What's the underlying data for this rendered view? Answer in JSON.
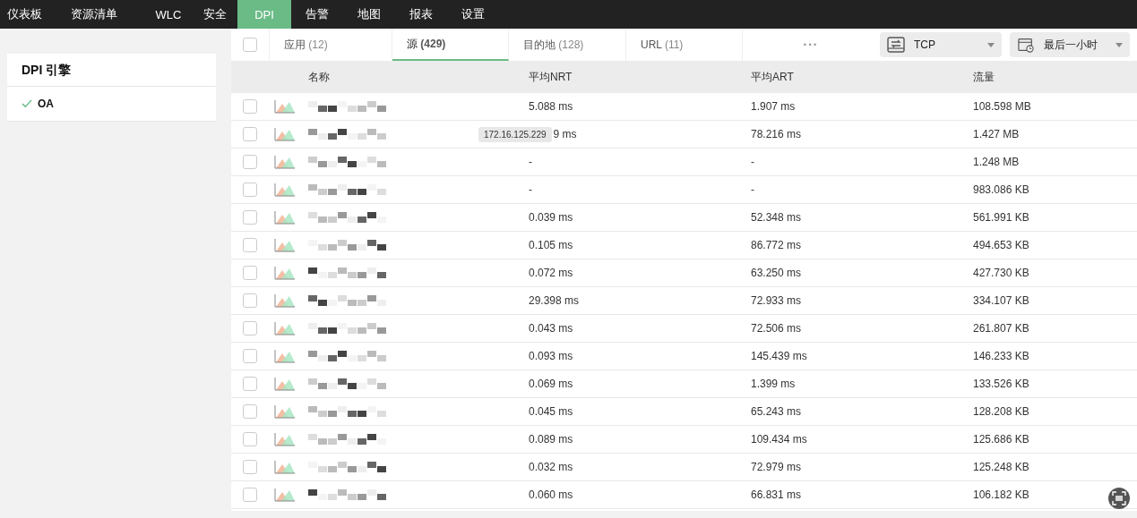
{
  "nav": [
    {
      "label": "仪表板",
      "selected": false
    },
    {
      "label": "资源清单",
      "selected": false
    },
    {
      "label": "WLC",
      "selected": false
    },
    {
      "label": "安全",
      "selected": false
    },
    {
      "label": "DPI",
      "selected": true
    },
    {
      "label": "告警",
      "selected": false
    },
    {
      "label": "地图",
      "selected": false
    },
    {
      "label": "报表",
      "selected": false
    },
    {
      "label": "设置",
      "selected": false
    }
  ],
  "sidebar": {
    "title": "DPI 引擎",
    "items": [
      {
        "label": "OA",
        "checked": true
      }
    ]
  },
  "tabs": [
    {
      "label": "应用",
      "count": "(12)",
      "selected": false
    },
    {
      "label": "源",
      "count": "(429)",
      "selected": true
    },
    {
      "label": "目的地",
      "count": "(128)",
      "selected": false
    },
    {
      "label": "URL",
      "count": "(11)",
      "selected": false
    }
  ],
  "more": "• • •",
  "protocol_select": {
    "value": "TCP"
  },
  "time_select": {
    "value": "最后一小时"
  },
  "table": {
    "columns": [
      "名称",
      "平均NRT",
      "平均ART",
      "流量"
    ],
    "select_all": {
      "checked": false
    },
    "rows": [
      {
        "checked": false,
        "nrt": "5.088 ms",
        "art": "1.907 ms",
        "traffic": "108.598 MB"
      },
      {
        "checked": false,
        "nrt": "9 ms",
        "art": "78.216 ms",
        "traffic": "1.427 MB",
        "tooltip": "172.16.125.229"
      },
      {
        "checked": false,
        "nrt": "-",
        "art": "-",
        "traffic": "1.248 MB"
      },
      {
        "checked": false,
        "nrt": "-",
        "art": "-",
        "traffic": "983.086 KB"
      },
      {
        "checked": false,
        "nrt": "0.039 ms",
        "art": "52.348 ms",
        "traffic": "561.991 KB"
      },
      {
        "checked": false,
        "nrt": "0.105 ms",
        "art": "86.772 ms",
        "traffic": "494.653 KB"
      },
      {
        "checked": false,
        "nrt": "0.072 ms",
        "art": "63.250 ms",
        "traffic": "427.730 KB"
      },
      {
        "checked": false,
        "nrt": "29.398 ms",
        "art": "72.933 ms",
        "traffic": "334.107 KB"
      },
      {
        "checked": false,
        "nrt": "0.043 ms",
        "art": "72.506 ms",
        "traffic": "261.807 KB"
      },
      {
        "checked": false,
        "nrt": "0.093 ms",
        "art": "145.439 ms",
        "traffic": "146.233 KB"
      },
      {
        "checked": false,
        "nrt": "0.069 ms",
        "art": "1.399 ms",
        "traffic": "133.526 KB"
      },
      {
        "checked": false,
        "nrt": "0.045 ms",
        "art": "65.243 ms",
        "traffic": "128.208 KB"
      },
      {
        "checked": false,
        "nrt": "0.089 ms",
        "art": "109.434 ms",
        "traffic": "125.686 KB"
      },
      {
        "checked": false,
        "nrt": "0.032 ms",
        "art": "72.979 ms",
        "traffic": "125.248 KB"
      },
      {
        "checked": false,
        "nrt": "0.060 ms",
        "art": "66.831 ms",
        "traffic": "106.182 KB"
      }
    ]
  }
}
